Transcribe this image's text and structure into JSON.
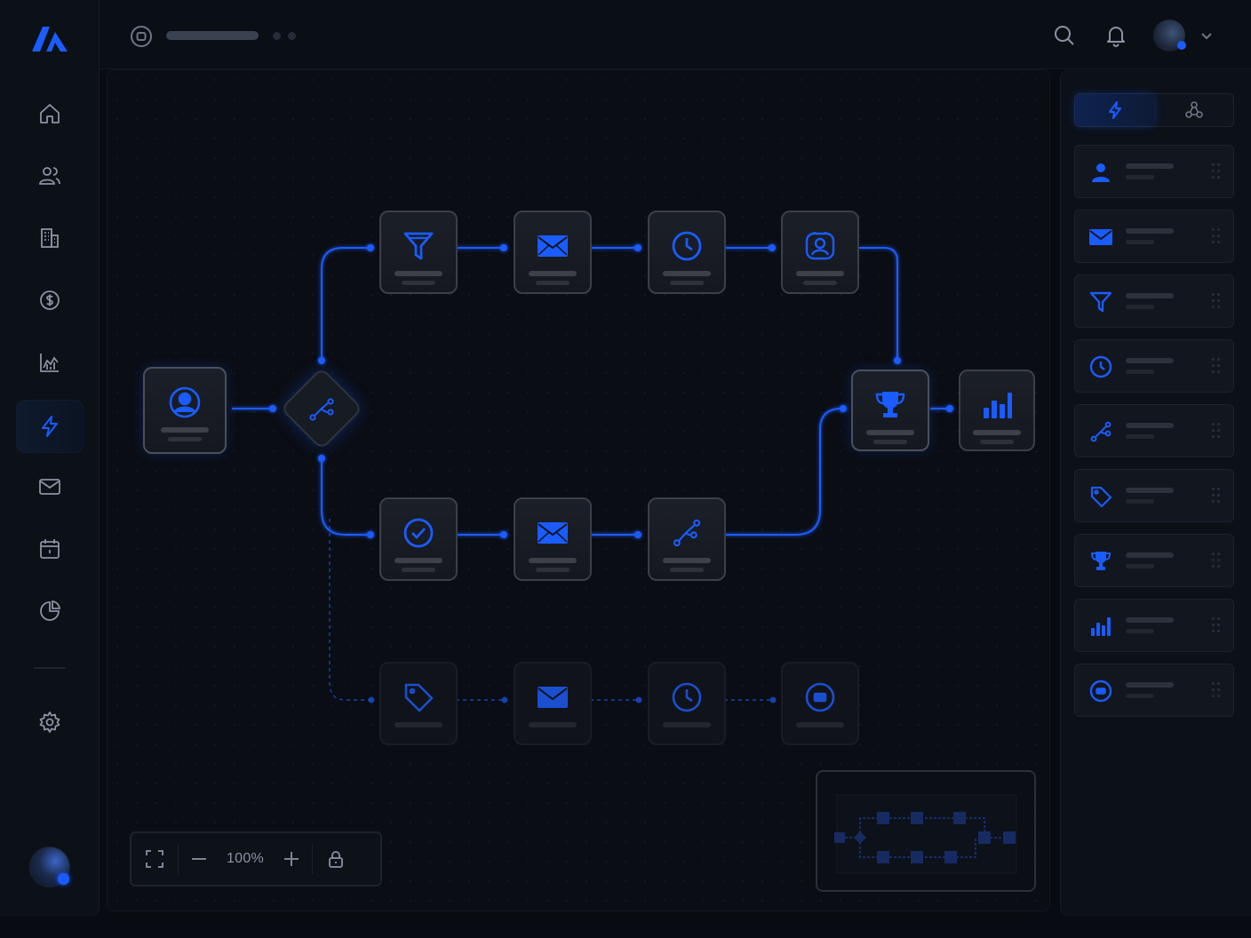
{
  "app": {
    "accent_color": "#1a5cff"
  },
  "sidebar": {
    "logo_icon": "brand-logo-icon",
    "items": [
      {
        "icon": "home-icon",
        "active": false
      },
      {
        "icon": "users-icon",
        "active": false
      },
      {
        "icon": "building-icon",
        "active": false
      },
      {
        "icon": "dollar-icon",
        "active": false
      },
      {
        "icon": "chart-line-icon",
        "active": false
      },
      {
        "icon": "lightning-icon",
        "active": true
      },
      {
        "icon": "mail-icon",
        "active": false
      },
      {
        "icon": "calendar-icon",
        "active": false
      },
      {
        "icon": "pie-chart-icon",
        "active": false
      }
    ],
    "settings_icon": "gear-icon"
  },
  "topbar": {
    "icons": [
      "search-icon",
      "bell-icon",
      "chevron-down-icon"
    ]
  },
  "canvas": {
    "zoom_label": "100%",
    "nodes": [
      {
        "id": "trigger-contact",
        "icon": "user-circle-icon"
      },
      {
        "id": "split",
        "icon": "branch-icon"
      },
      {
        "id": "filter",
        "icon": "filter-icon"
      },
      {
        "id": "email-1",
        "icon": "mail-icon"
      },
      {
        "id": "wait-1",
        "icon": "clock-icon"
      },
      {
        "id": "assign-owner",
        "icon": "contact-card-icon"
      },
      {
        "id": "goal",
        "icon": "trophy-icon"
      },
      {
        "id": "report",
        "icon": "bar-chart-icon"
      },
      {
        "id": "condition-check",
        "icon": "check-circle-icon"
      },
      {
        "id": "email-2",
        "icon": "mail-icon"
      },
      {
        "id": "split-2",
        "icon": "branch-icon"
      },
      {
        "id": "tag",
        "icon": "tag-icon"
      },
      {
        "id": "email-3",
        "icon": "mail-icon"
      },
      {
        "id": "wait-2",
        "icon": "clock-icon"
      },
      {
        "id": "end",
        "icon": "stop-icon"
      }
    ]
  },
  "panel": {
    "tabs": [
      {
        "icon": "lightning-icon",
        "active": true
      },
      {
        "icon": "nodes-icon",
        "active": false
      }
    ],
    "items": [
      {
        "icon": "user-icon"
      },
      {
        "icon": "mail-icon"
      },
      {
        "icon": "filter-icon"
      },
      {
        "icon": "clock-icon"
      },
      {
        "icon": "branch-icon"
      },
      {
        "icon": "tag-icon"
      },
      {
        "icon": "trophy-icon"
      },
      {
        "icon": "bar-chart-icon"
      },
      {
        "icon": "stop-icon"
      }
    ]
  }
}
